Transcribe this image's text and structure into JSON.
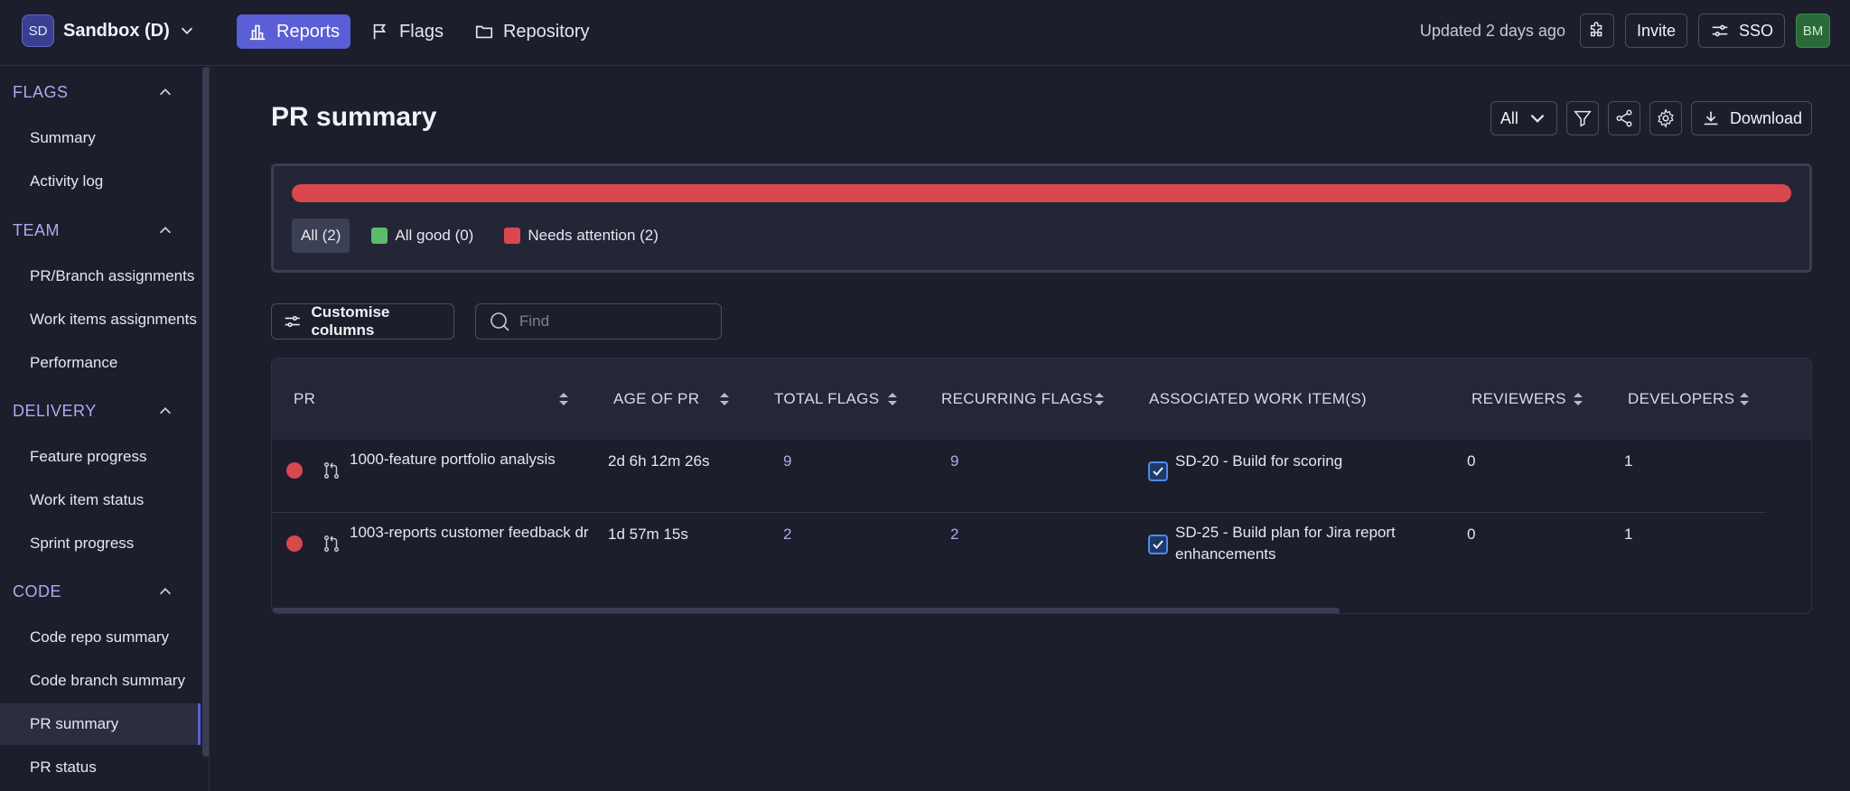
{
  "workspace": {
    "initials": "SD",
    "name": "Sandbox (D)"
  },
  "nav": [
    {
      "label": "Reports",
      "icon": "chart-bar-icon",
      "active": true
    },
    {
      "label": "Flags",
      "icon": "flag-icon",
      "active": false
    },
    {
      "label": "Repository",
      "icon": "folder-icon",
      "active": false
    }
  ],
  "topbar": {
    "updated": "Updated 2 days ago",
    "invite_label": "Invite",
    "sso_label": "SSO",
    "user_initials": "BM"
  },
  "sidebar": {
    "sections": [
      {
        "title": "FLAGS",
        "items": [
          "Summary",
          "Activity log"
        ]
      },
      {
        "title": "TEAM",
        "items": [
          "PR/Branch assignments",
          "Work items assignments",
          "Performance"
        ]
      },
      {
        "title": "DELIVERY",
        "items": [
          "Feature progress",
          "Work item status",
          "Sprint progress"
        ]
      },
      {
        "title": "CODE",
        "items": [
          "Code repo summary",
          "Code branch summary",
          "PR summary",
          "PR status"
        ]
      }
    ],
    "active_item": "PR summary"
  },
  "page": {
    "title": "PR summary",
    "filter_value": "All",
    "download_label": "Download"
  },
  "summary": {
    "needs_attention_fraction": 1.0,
    "legend": [
      {
        "label": "All (2)",
        "color": "",
        "active": true
      },
      {
        "label": "All good (0)",
        "color": "#5dbb6a",
        "active": false
      },
      {
        "label": "Needs attention (2)",
        "color": "#d9474f",
        "active": false
      }
    ]
  },
  "toolbar": {
    "customise_label": "Customise columns",
    "find_placeholder": "Find"
  },
  "table": {
    "columns": [
      "PR",
      "AGE OF PR",
      "TOTAL FLAGS",
      "RECURRING FLAGS",
      "ASSOCIATED WORK ITEM(S)",
      "REVIEWERS",
      "DEVELOPERS"
    ],
    "rows": [
      {
        "pr": "1000-feature portfolio analysis",
        "age": "2d 6h 12m 26s",
        "total_flags": "9",
        "recurring_flags": "9",
        "work_item": "SD-20 - Build for scoring",
        "reviewers": "0",
        "developers": "1"
      },
      {
        "pr": "1003-reports customer feedback dr",
        "age": "1d 57m 15s",
        "total_flags": "2",
        "recurring_flags": "2",
        "work_item": "SD-25 - Build plan for Jira report enhancements",
        "reviewers": "0",
        "developers": "1"
      }
    ]
  }
}
